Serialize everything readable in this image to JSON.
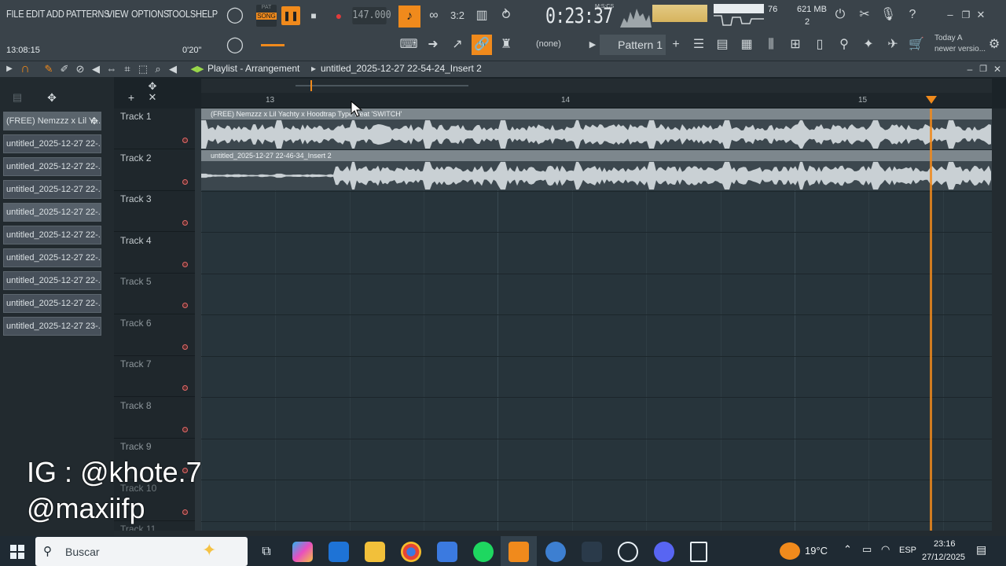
{
  "menu": [
    "FILE",
    "EDIT",
    "ADD",
    "PATTERNS",
    "VIEW",
    "OPTIONS",
    "TOOLS",
    "HELP"
  ],
  "transport": {
    "pat_label": "PAT",
    "song_label": "SONG",
    "tempo": "147.000",
    "song_time": "0:23:37",
    "time_format": "M:S:CS",
    "cpu": "76",
    "memory": "621 MB",
    "polyphony": "2"
  },
  "hint_bar": {
    "time": "13:08:15",
    "offset": "0'20\""
  },
  "pattern": {
    "name": "Pattern 1",
    "channel_target": "(none)"
  },
  "news": {
    "line1": "Today  A",
    "line2": "newer versio..."
  },
  "playlist": {
    "title": "Playlist - Arrangement",
    "project": "untitled_2025-12-27 22-54-24_Insert 2",
    "bars": [
      "13",
      "14",
      "15"
    ]
  },
  "clips": [
    "(FREE) Nemzzz x Lil Y...",
    "untitled_2025-12-27 22-...",
    "untitled_2025-12-27 22-...",
    "untitled_2025-12-27 22-...",
    "untitled_2025-12-27 22-...",
    "untitled_2025-12-27 22-...",
    "untitled_2025-12-27 22-...",
    "untitled_2025-12-27 22-...",
    "untitled_2025-12-27 22-...",
    "untitled_2025-12-27 23-..."
  ],
  "tracks": [
    "Track 1",
    "Track 2",
    "Track 3",
    "Track 4",
    "Track 5",
    "Track 6",
    "Track 7",
    "Track 8",
    "Track 9",
    "Track 10",
    "Track 11"
  ],
  "audio_clips": [
    {
      "label": "(FREE) Nemzzz x Lil Yachty x Hoodtrap Type Beat 'SWITCH'"
    },
    {
      "label": "untitled_2025-12-27 22-46-34_Insert 2"
    }
  ],
  "watermark": {
    "line1": "IG : @khote.7",
    "line2": "@maxiifp"
  },
  "taskbar": {
    "search_placeholder": "Buscar",
    "weather": "19°C",
    "language": "ESP",
    "clock_time": "23:16",
    "clock_date": "27/12/2025"
  },
  "colors": {
    "accent": "#f08a1c",
    "record": "#e23b3b",
    "panel": "#3a434a",
    "grid": "#27343b"
  }
}
